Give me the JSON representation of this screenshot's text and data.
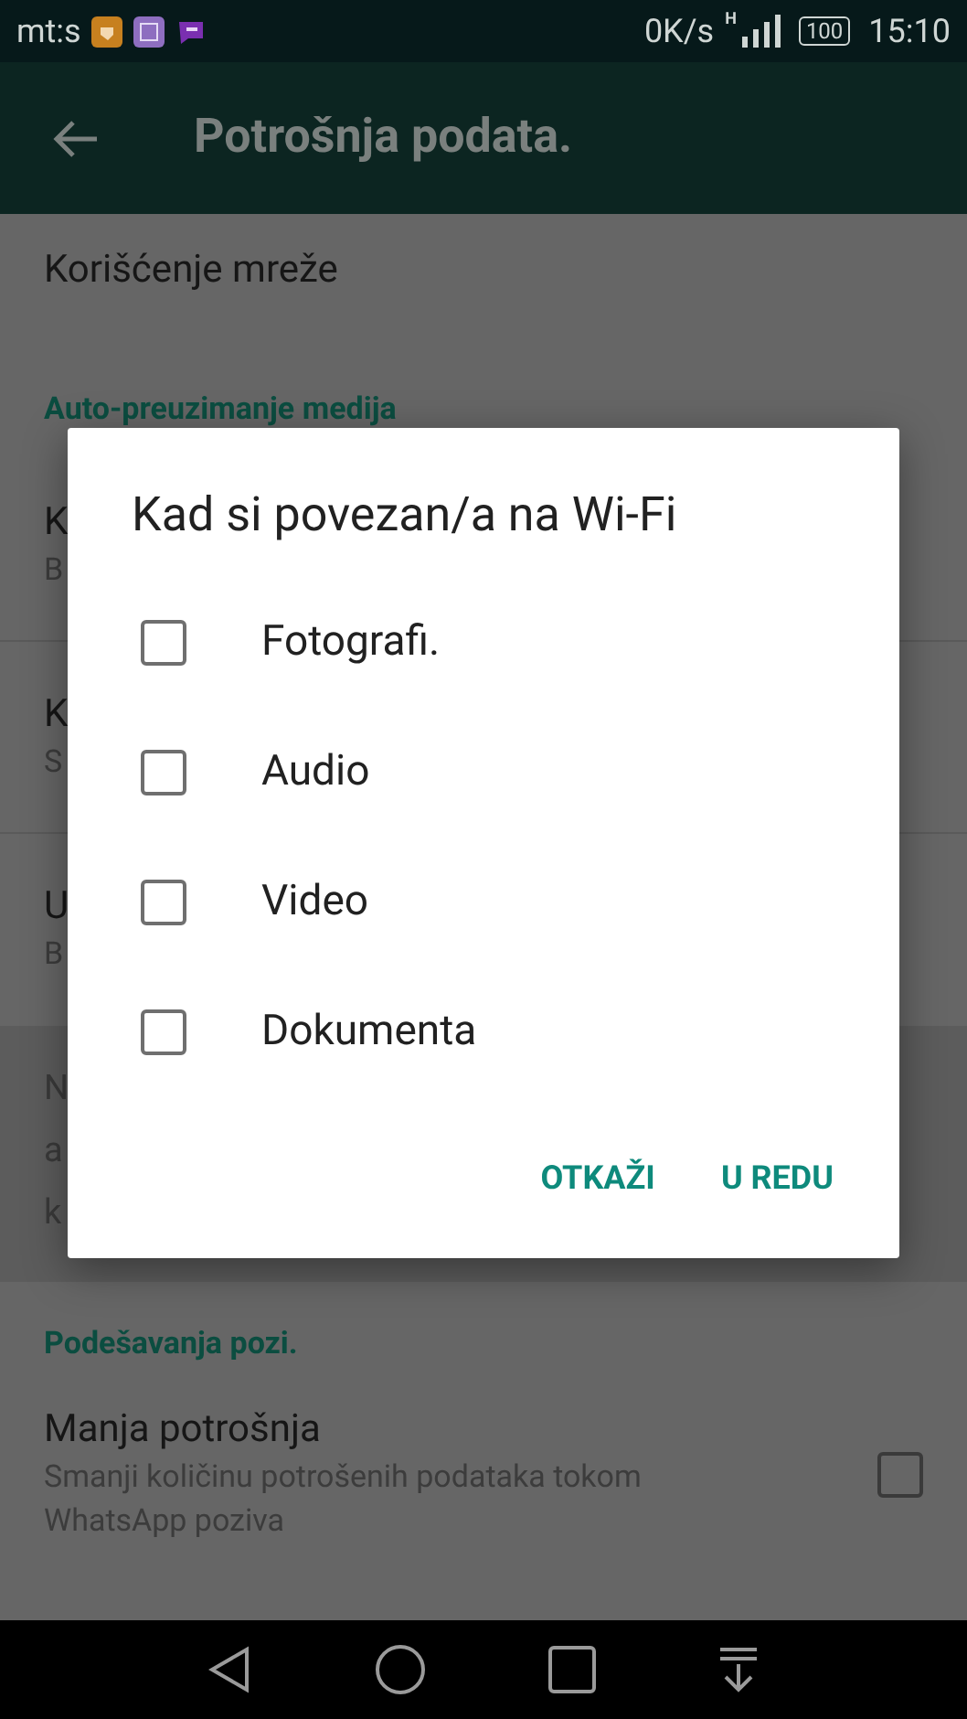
{
  "status_bar": {
    "carrier": "mt:s",
    "speed": "0K/s",
    "network": "H",
    "battery": "100",
    "time": "15:10"
  },
  "app_bar": {
    "title": "Potrošnja podata."
  },
  "items": [
    {
      "kind": "row",
      "title": "Korišćenje mreže"
    },
    {
      "kind": "header",
      "title": "Auto-preuzimanje medija"
    },
    {
      "kind": "row",
      "title": "K",
      "subtitle": "B"
    },
    {
      "kind": "row",
      "title": "K",
      "subtitle": "S"
    },
    {
      "kind": "row",
      "title": "U",
      "subtitle": "B"
    },
    {
      "kind": "note",
      "lines": [
        "N",
        "a",
        "k"
      ]
    },
    {
      "kind": "header",
      "title": "Podešavanja pozi."
    },
    {
      "kind": "check",
      "title": "Manja potrošnja",
      "subtitle": "Smanji količinu potrošenih podataka tokom WhatsApp poziva",
      "checked": false
    }
  ],
  "dialog": {
    "title": "Kad si povezan/a na Wi-Fi",
    "options": [
      {
        "label": "Fotografi.",
        "checked": false
      },
      {
        "label": "Audio",
        "checked": false
      },
      {
        "label": "Video",
        "checked": false
      },
      {
        "label": "Dokumenta",
        "checked": false
      }
    ],
    "buttons": [
      "OTKAŽI",
      "U REDU"
    ]
  }
}
